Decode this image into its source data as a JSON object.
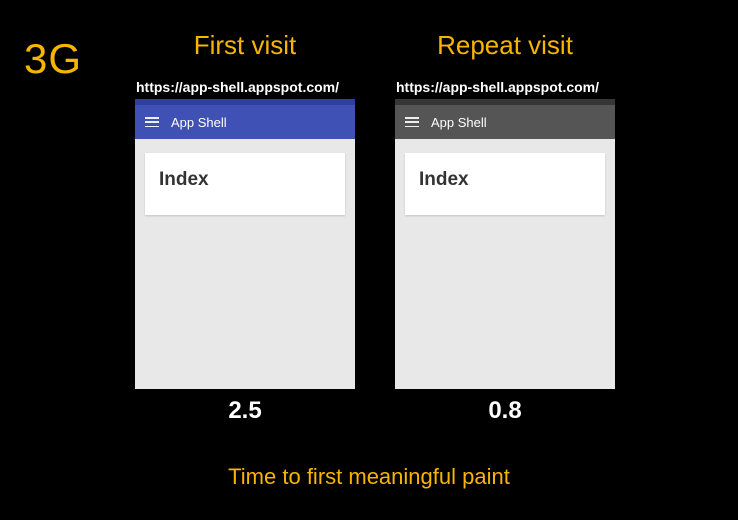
{
  "network_label": "3G",
  "caption": "Time to first meaningful paint",
  "columns": {
    "first": {
      "title": "First visit",
      "url": "https://app-shell.appspot.com/",
      "app_title": "App Shell",
      "card_title": "Index",
      "timing": "2.5"
    },
    "repeat": {
      "title": "Repeat visit",
      "url": "https://app-shell.appspot.com/",
      "app_title": "App Shell",
      "card_title": "Index",
      "timing": "0.8"
    }
  }
}
